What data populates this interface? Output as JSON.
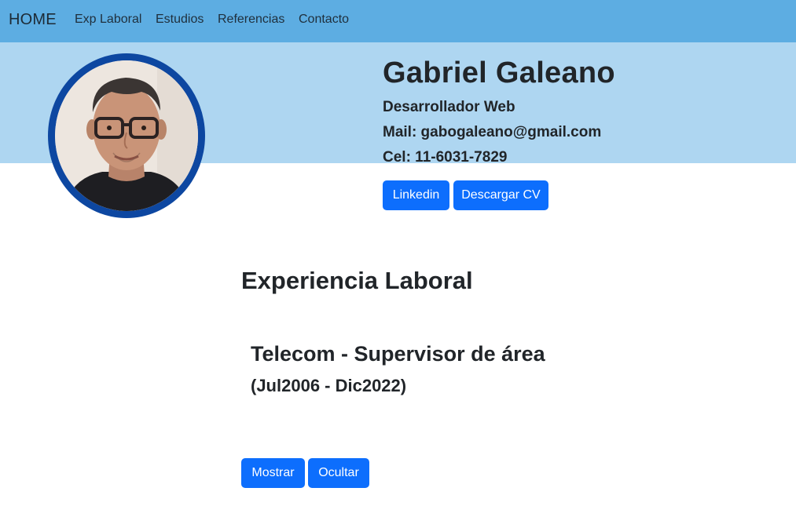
{
  "navbar": {
    "brand": "HOME",
    "links": [
      "Exp Laboral",
      "Estudios",
      "Referencias",
      "Contacto"
    ]
  },
  "profile": {
    "name": "Gabriel Galeano",
    "role": "Desarrollador Web",
    "mail": "Mail: gabogaleano@gmail.com",
    "cel": "Cel: 11-6031-7829",
    "buttons": {
      "linkedin": "Linkedin",
      "cv": "Descargar CV"
    }
  },
  "experience": {
    "title": "Experiencia Laboral",
    "job": {
      "title": "Telecom - Supervisor de área",
      "dates": "(Jul2006 - Dic2022)"
    },
    "buttons": {
      "show": "Mostrar",
      "hide": "Ocultar"
    }
  },
  "colors": {
    "navbar": "#5dade2",
    "hero": "#aed6f1",
    "button": "#0d6efd",
    "avatar_border": "#0d47a1"
  }
}
